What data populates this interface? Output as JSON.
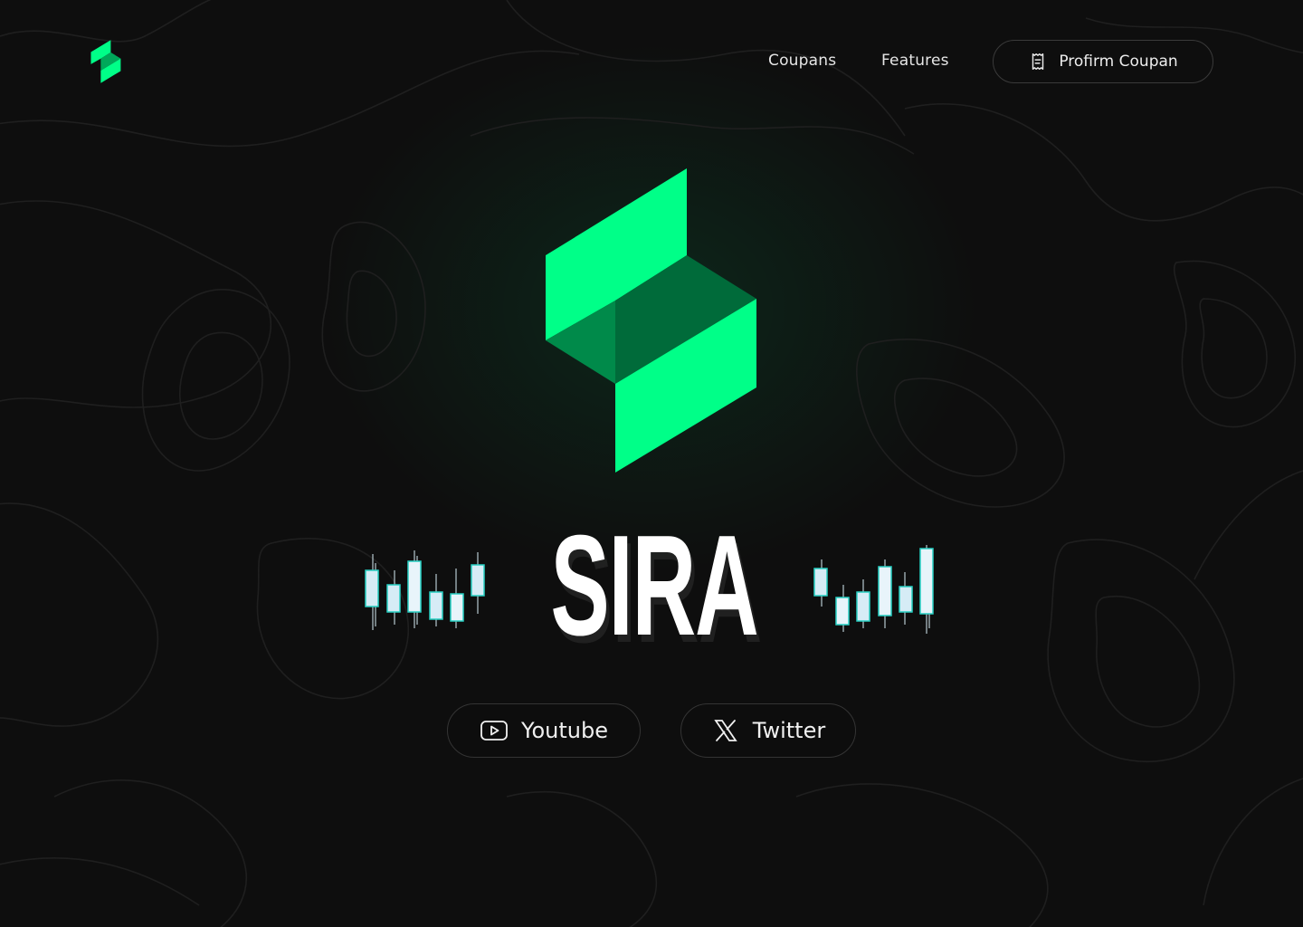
{
  "brand": {
    "name": "SIRA",
    "accent_color": "#00ff88",
    "accent_dark": "#00a85a",
    "logo_icon": "sira-s-logo-icon"
  },
  "nav": {
    "links": [
      {
        "label": "Coupans"
      },
      {
        "label": "Features"
      }
    ],
    "cta": {
      "label": "Profirm Coupan",
      "icon": "receipt-icon"
    }
  },
  "hero": {
    "title": "SIRA",
    "decor": {
      "left": "candlestick-chart-icon",
      "right": "candlestick-chart-icon"
    }
  },
  "social": [
    {
      "label": "Youtube",
      "icon": "youtube-play-icon"
    },
    {
      "label": "Twitter",
      "icon": "x-logo-icon"
    }
  ]
}
